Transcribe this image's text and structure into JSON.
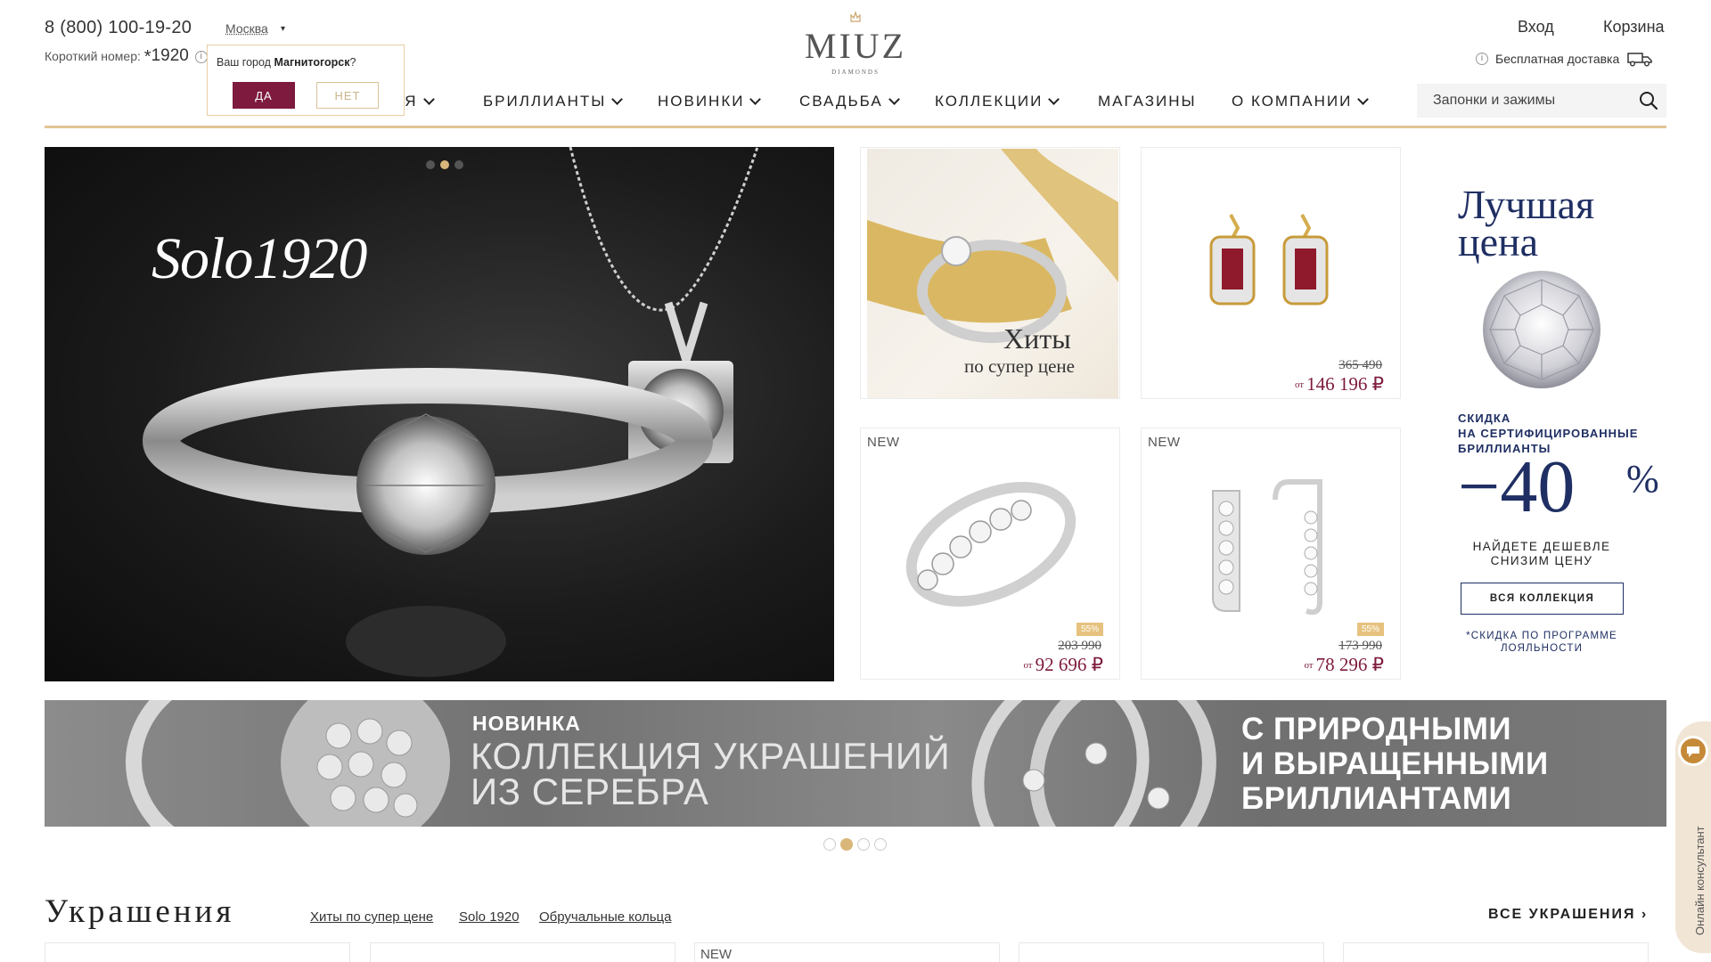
{
  "header": {
    "phone": "8 (800) 100-19-20",
    "short_label": "Короткий номер:",
    "short_star": "*",
    "short_number": "1920",
    "info": "i",
    "city": "Москва",
    "city_arrow": "▾",
    "popup": {
      "question_prefix": "Ваш город ",
      "question_city": "Магнитогорск",
      "question_suffix": "?",
      "yes": "ДА",
      "no": "НЕТ"
    },
    "logo": "MIUZ",
    "logo_sub": "DIAMONDS",
    "login": "Вход",
    "cart": "Корзина",
    "delivery": "Бесплатная доставка"
  },
  "nav": {
    "items": [
      {
        "label": "ИЯ",
        "has_dropdown": true
      },
      {
        "label": "БРИЛЛИАНТЫ",
        "has_dropdown": true
      },
      {
        "label": "НОВИНКИ",
        "has_dropdown": true
      },
      {
        "label": "СВАДЬБА",
        "has_dropdown": true
      },
      {
        "label": "КОЛЛЕКЦИИ",
        "has_dropdown": true
      },
      {
        "label": "МАГАЗИНЫ",
        "has_dropdown": false
      },
      {
        "label": "О КОМПАНИИ",
        "has_dropdown": true
      }
    ],
    "search_value": "Запонки и зажимы"
  },
  "hero": {
    "title": "Solo1920",
    "active_slide": 2,
    "slides": 3
  },
  "tiles": {
    "hits": {
      "title": "Хиты",
      "subtitle": "по супер цене"
    },
    "earrings_ruby": {
      "old_price": "365 490",
      "from": "от",
      "price": "146 196 ₽"
    },
    "ring_eternity": {
      "badge": "NEW",
      "discount": "55%",
      "old_price": "203 990",
      "from": "от",
      "price": "92 696 ₽"
    },
    "earrings_hoop": {
      "badge": "NEW",
      "discount": "55%",
      "old_price": "173 990",
      "from": "от",
      "price": "78 296 ₽"
    }
  },
  "promo": {
    "title_line1": "Лучшая",
    "title_line2": "цена",
    "sub_line1": "СКИДКА",
    "sub_line2": "НА СЕРТИФИЦИРОВАННЫЕ",
    "sub_line3": "БРИЛЛИАНТЫ",
    "percent": "−40",
    "percent_sign": "%",
    "find_line1": "НАЙДЕТЕ ДЕШЕВЛЕ",
    "find_line2": "СНИЗИМ ЦЕНУ",
    "button": "ВСЯ КОЛЛЕКЦИЯ",
    "note_line1": "*СКИДКА ПО ПРОГРАММЕ",
    "note_line2": "ЛОЯЛЬНОСТИ"
  },
  "banner": {
    "badge": "НОВИНКА",
    "line1": "КОЛЛЕКЦИЯ УКРАШЕНИЙ",
    "line2": "ИЗ СЕРЕБРА",
    "right_line1": "С ПРИРОДНЫМИ",
    "right_line2": "И ВЫРАЩЕННЫМИ",
    "right_line3": "БРИЛЛИАНТАМИ",
    "active_slide": 2,
    "slides": 4
  },
  "section": {
    "title": "Украшения",
    "links": [
      "Хиты по супер цене",
      "Solo 1920",
      "Обручальные кольца"
    ],
    "all": "ВСЕ УКРАШЕНИЯ",
    "all_arrow": "›",
    "card_badge": "NEW"
  },
  "consultant": {
    "label": "Онлайн консультант"
  },
  "colors": {
    "accent_gold": "#e3c495",
    "brand_burgundy": "#7d1a3d",
    "promo_navy": "#1f2f63"
  }
}
